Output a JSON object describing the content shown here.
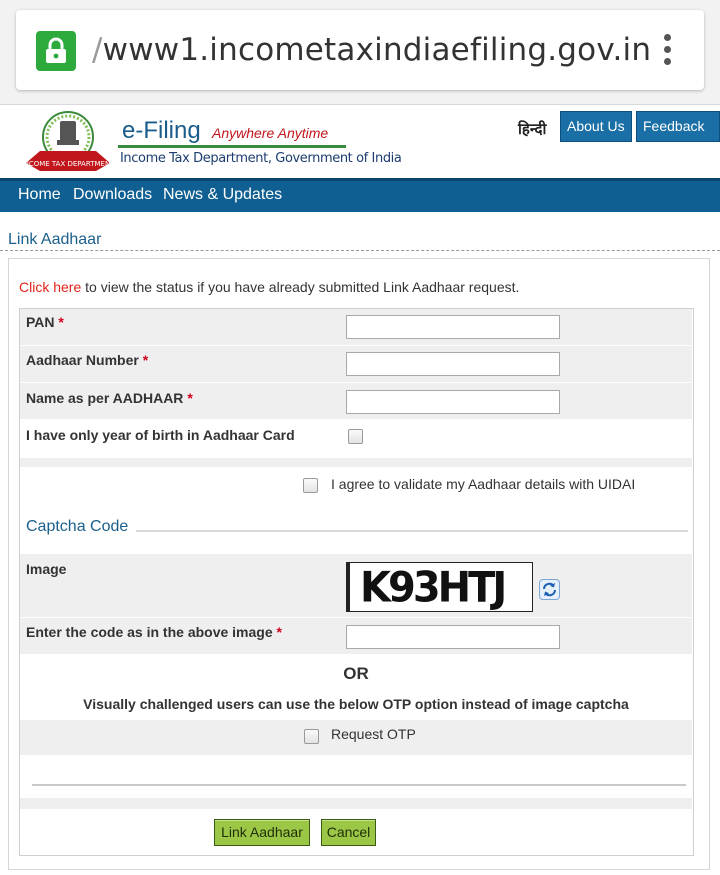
{
  "browser": {
    "url_prefix": "/",
    "url": "www1.incometaxindiaefiling.gov.in",
    "icons": [
      "lock-icon",
      "kebab-menu-icon"
    ],
    "lock_color": "#2eaa3d"
  },
  "header": {
    "brand": "e-Filing",
    "tagline": "Anywhere Anytime",
    "department": "Income Tax Department, Government of India",
    "emblem_text": "INCOME TAX DEPARTMENT",
    "language_link": "हिन्दी",
    "about_button": "About Us",
    "feedback_button": "Feedback"
  },
  "nav": {
    "items": [
      {
        "label": "Home"
      },
      {
        "label": "Downloads"
      },
      {
        "label": "News & Updates"
      }
    ],
    "color": "#0f5f92"
  },
  "page": {
    "title": "Link Aadhaar",
    "status_link": "Click here",
    "status_text": " to view the status if you have already submitted Link Aadhaar request."
  },
  "form": {
    "required_marker": "*",
    "pan_label": "PAN",
    "aadhaar_label": "Aadhaar Number",
    "name_label": "Name as per AADHAAR",
    "yob_label": "I have only year of birth in Aadhaar Card",
    "agree_label": "I agree to validate my Aadhaar details with UIDAI",
    "captcha_heading": "Captcha Code",
    "image_label": "Image",
    "captcha_value": "K93HTJ",
    "code_label": "Enter the code as in the above image",
    "or_text": "OR",
    "otp_note": "Visually challenged users can use the below OTP option instead of image captcha",
    "otp_label": "Request OTP",
    "submit_button": "Link Aadhaar",
    "cancel_button": "Cancel",
    "button_color": "#9bc646"
  }
}
